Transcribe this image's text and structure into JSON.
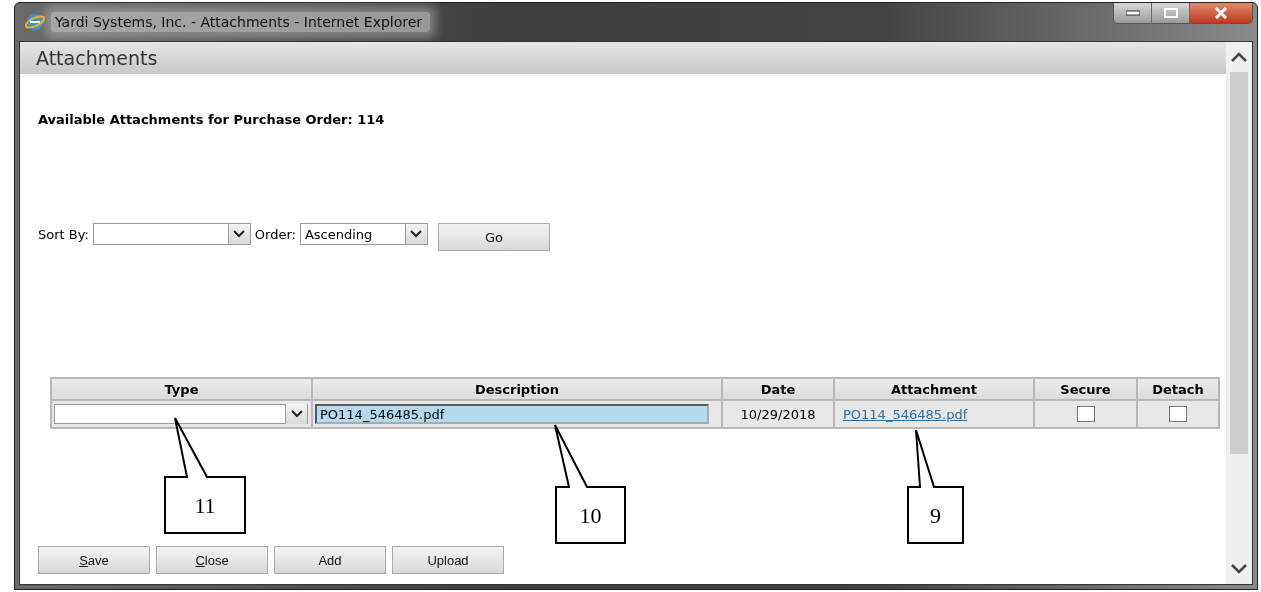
{
  "window": {
    "title": "Yardi Systems, Inc. - Attachments - Internet Explorer"
  },
  "panel": {
    "title": "Attachments"
  },
  "heading": "Available Attachments for Purchase Order: 114",
  "sort": {
    "sort_by_label": "Sort By:",
    "order_label": "Order:",
    "order_value": "Ascending",
    "go": "Go"
  },
  "table": {
    "columns": [
      "Type",
      "Description",
      "Date",
      "Attachment",
      "Secure",
      "Detach"
    ],
    "rows": [
      {
        "description": "PO114_546485.pdf",
        "description_highlighted": true,
        "date": "10/29/2018",
        "attachment": "PO114_546485.pdf",
        "secure": false,
        "detach": false
      }
    ]
  },
  "buttons": [
    {
      "label": "Save",
      "mnemonic": true
    },
    {
      "label": "Close",
      "mnemonic": true
    },
    {
      "label": "Add",
      "mnemonic": false
    },
    {
      "label": "Upload",
      "mnemonic": false
    }
  ],
  "callouts": [
    "11",
    "10",
    "9"
  ]
}
